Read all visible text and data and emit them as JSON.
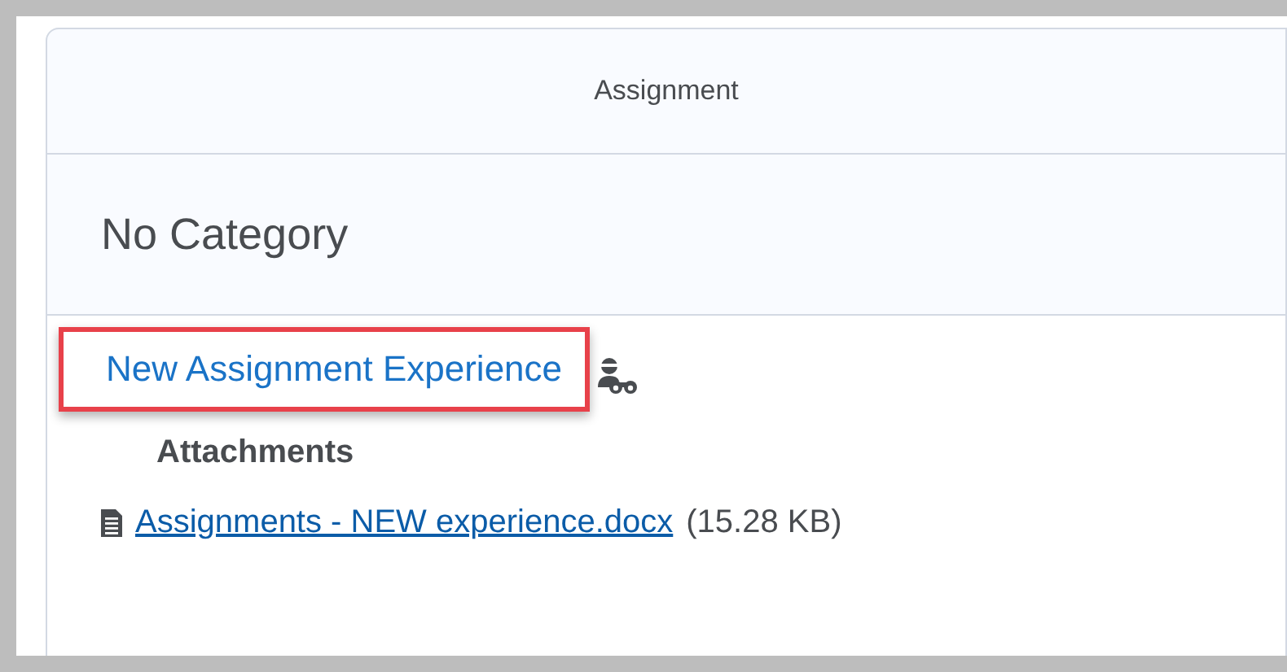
{
  "table": {
    "columns": [
      "Assignment"
    ],
    "category": "No Category",
    "item": {
      "title": "New Assignment Experience",
      "highlighted": true,
      "attachments_heading": "Attachments",
      "attachments": [
        {
          "name": "Assignments - NEW experience.docx",
          "size": "(15.28 KB)"
        }
      ]
    }
  }
}
